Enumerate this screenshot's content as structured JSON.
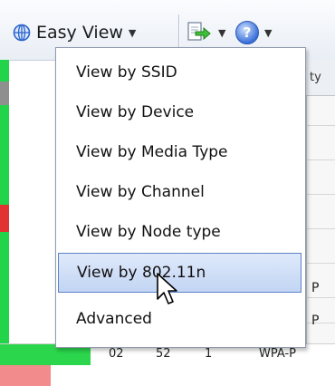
{
  "toolbar": {
    "easy_view_label": "Easy View",
    "easy_view_icon": "globe-icon",
    "export_icon": "export-icon",
    "help_icon": "help-icon",
    "help_glyph": "?"
  },
  "menu": {
    "items": [
      {
        "label": "View by SSID"
      },
      {
        "label": "View by Device"
      },
      {
        "label": "View by Media Type"
      },
      {
        "label": "View by Channel"
      },
      {
        "label": "View by Node type"
      },
      {
        "label": "View by 802.11n",
        "selected": true
      },
      {
        "label": "Advanced"
      }
    ]
  },
  "background_table": {
    "header_fragment": "ty",
    "cell_fragments": [
      "P",
      "P"
    ],
    "bottom_row": [
      "02",
      "52",
      "1",
      "WPA-P"
    ]
  },
  "colors": {
    "status_green": "#22d44a",
    "status_red": "#e23333",
    "highlight": "#c2d5f3"
  }
}
